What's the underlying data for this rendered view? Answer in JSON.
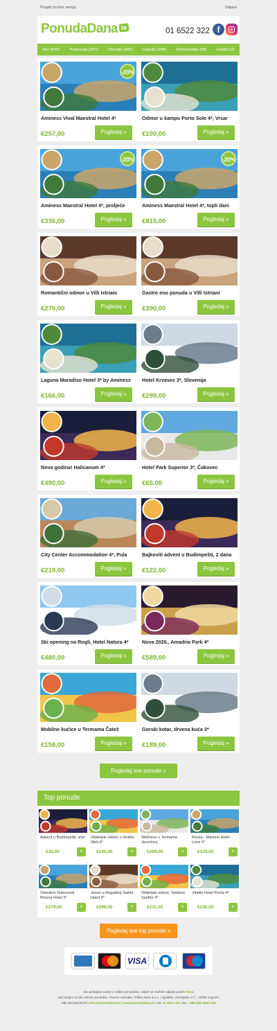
{
  "topbar": {
    "online_link": "Posjeti on-line verziju",
    "unsubscribe": "Odjava"
  },
  "header": {
    "logo_text": "PonudaDana",
    "logo_suffix": "hr",
    "phone": "01 6522 322",
    "facebook_icon": "f"
  },
  "nav": [
    "Sve (675)",
    "Putovanja (267)",
    "Zdravlje (160)",
    "Ljepota (148)",
    "Obrazovanje (50)",
    "Gastro (3)"
  ],
  "button_label": "Pogledaj »",
  "offers": [
    {
      "title": "Aminess Vival Maestral Hotel 4*",
      "price": "€257,00",
      "badge": "-20%",
      "theme": "coast"
    },
    {
      "title": "Odmor u kampu Porto Sole 4*, Vrsar",
      "price": "€100,00",
      "badge": "",
      "theme": "aerial"
    },
    {
      "title": "Aminess Maestral Hotel 4*, proljeće",
      "price": "€336,00",
      "badge": "-20%",
      "theme": "coast"
    },
    {
      "title": "Aminess Maestral Hotel 4*, topli dani",
      "price": "€815,00",
      "badge": "-20%",
      "theme": "coast"
    },
    {
      "title": "Romantični odmor u Villi Istriani",
      "price": "€270,00",
      "badge": "",
      "theme": "spa"
    },
    {
      "title": "Gastro eno ponuda u Villi Istriani",
      "price": "€390,00",
      "badge": "",
      "theme": "spa"
    },
    {
      "title": "Laguna Maradiso Hotel 3* by Aminess",
      "price": "€166,00",
      "badge": "",
      "theme": "aerial"
    },
    {
      "title": "Hotel Krvavec 3*, Slovenija",
      "price": "€299,00",
      "badge": "",
      "theme": "snow"
    },
    {
      "title": "Nova godina! Halicanum 4*",
      "price": "€490,00",
      "badge": "",
      "theme": "night"
    },
    {
      "title": "Hotel Park Superior 3*, Čakovec",
      "price": "€65,00",
      "badge": "",
      "theme": "hotel"
    },
    {
      "title": "City Center Accommodation 4*, Pula",
      "price": "€219,00",
      "badge": "",
      "theme": "city"
    },
    {
      "title": "Bajkoviti advent u Budimpešti, 2 dana",
      "price": "€122,00",
      "badge": "",
      "theme": "night"
    },
    {
      "title": "Ski opening na Rogli, Hotel Natura 4*",
      "price": "€480,00",
      "badge": "",
      "theme": "ski"
    },
    {
      "title": "Nova 2026., Amadria Park 4*",
      "price": "€589,00",
      "badge": "",
      "theme": "party"
    },
    {
      "title": "Mobilne kućice u Termama Čatež",
      "price": "€158,00",
      "badge": "",
      "theme": "pool"
    },
    {
      "title": "Gorski kotar, drvena kuća 3*",
      "price": "€189,00",
      "badge": "",
      "theme": "snow"
    }
  ],
  "all_offers_button": "Pogledaj sve ponude »",
  "top_offers": {
    "heading": "Top ponude",
    "items": [
      {
        "title": "Advent u Budimpešti, izlet",
        "price": "€39,00",
        "theme": "night"
      },
      {
        "title": "Obiteljski odmor u Hotelu Well 4*",
        "price": "€245,00",
        "theme": "pool"
      },
      {
        "title": "Wellness u Termama Jezerčica",
        "price": "€269,00",
        "theme": "hotel"
      },
      {
        "title": "Rovinj - Maistrin Hotel Lone 5*",
        "price": "€329,00",
        "theme": "coast"
      },
      {
        "title": "Sheraton Dubrovnik Riviera Hotel 5*",
        "price": "€279,00",
        "theme": "coast"
      },
      {
        "title": "Jesen u Rogaškoj Slatini, Hotel 4*",
        "price": "€299,00",
        "theme": "spa"
      },
      {
        "title": "Obiteljski odmor, Valamar Sanfior 4*",
        "price": "€231,00",
        "theme": "pool"
      },
      {
        "title": "Vitality Hotel Punta 4*",
        "price": "€230,00",
        "theme": "aerial"
      }
    ],
    "button_label": "»"
  },
  "top_offers_button": "Pogledaj sve top ponude »",
  "payment_cards": [
    "AMEX",
    "MasterCard",
    "VISA",
    "Diners",
    "Maestro"
  ],
  "footer": {
    "line1_prefix": "Ako postajete ovisni o našim ponudama, uvijek se možete odjaviti putem",
    "line1_link": "linka.",
    "line2": "Vaš zahtjev će biti odmah proveden. Pravne naznake: Prilika dana d.o.o. | Sjedište: Zvečajska 17 | , 10000 Zagreb |",
    "oib": "OIB 43728211079 |",
    "email": "info@ponudadana.hr",
    "web": "www.ponudadana.hr",
    "tel_label": "tel:",
    "tel": "01 6522 322",
    "fax_label": "fax:",
    "fax": "+385 (0)1 6522 264"
  },
  "colors": {
    "brand_green": "#8cc63f",
    "price_green": "#7db52c",
    "orange": "#f7941d",
    "background": "#eeeeee"
  }
}
